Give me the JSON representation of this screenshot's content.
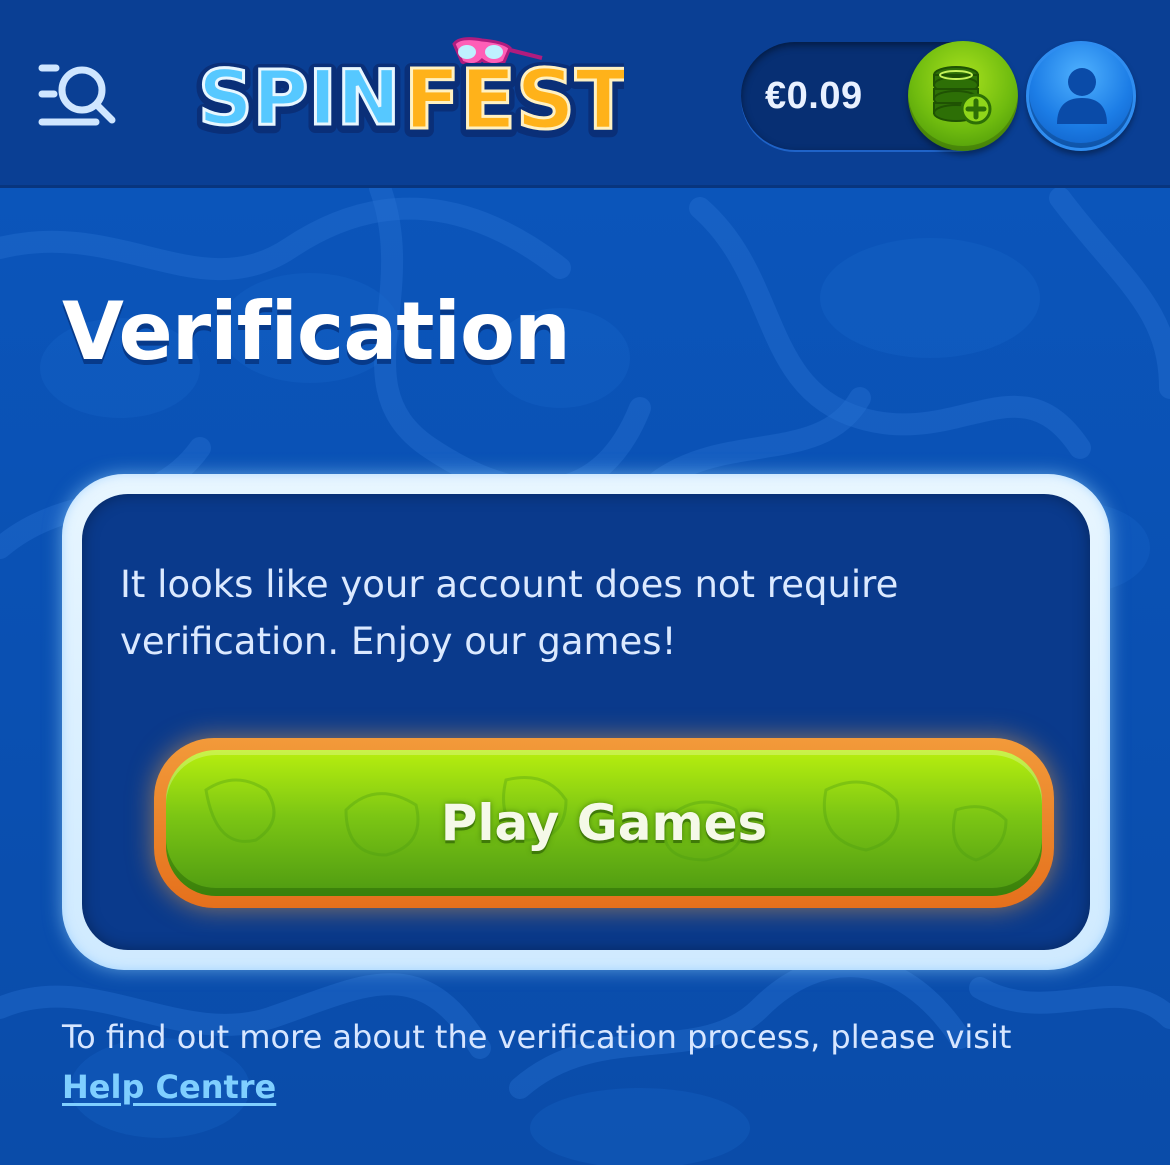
{
  "header": {
    "brand": {
      "part1": "SPIN",
      "part2": "FEST"
    },
    "balance": "€0.09",
    "icons": {
      "menu": "menu-search-icon",
      "deposit": "coins-plus-icon",
      "profile": "user-icon"
    }
  },
  "main": {
    "title": "Verification",
    "card": {
      "message": "It looks like your account does not require verification. Enjoy our games!",
      "button_label": "Play Games"
    },
    "footer": {
      "text": "To find out more about the verification process, please visit",
      "link_label": "Help Centre"
    }
  },
  "colors": {
    "header_bg": "#0a3f94",
    "page_bg": "#0a4fb0",
    "card_bg": "#0a3a8c",
    "button_green": "#7cc614",
    "button_orange": "#e5701c",
    "link": "#7fcfff"
  }
}
